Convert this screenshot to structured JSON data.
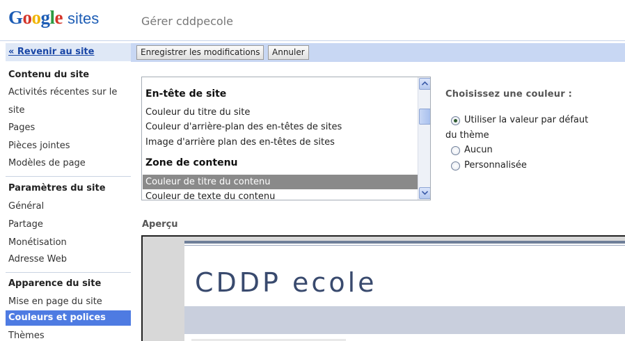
{
  "header": {
    "logo_google": "Google",
    "logo_sites": "sites",
    "title": "Gérer cddpecole",
    "colors": {
      "blue": "#1d5db5",
      "red": "#d4352a",
      "yellow": "#f0b400",
      "green": "#2c9a41"
    }
  },
  "sidebar": {
    "back_link": "« Revenir au site",
    "sections": [
      {
        "title": "Contenu du site",
        "items": [
          "Activités récentes sur le",
          "site",
          "Pages",
          "Pièces jointes",
          "Modèles de page"
        ]
      },
      {
        "title": "Paramètres du site",
        "items": [
          "Général",
          "Partage",
          "Monétisation",
          "Adresse Web"
        ]
      },
      {
        "title": "Apparence du site",
        "items": [
          "Mise en page du site",
          "Couleurs et polices",
          "Thèmes"
        ]
      }
    ],
    "selected": "Couleurs et polices"
  },
  "toolbar": {
    "save_label": "Enregistrer les modifications",
    "cancel_label": "Annuler"
  },
  "list": {
    "clipped_top": "",
    "sections": [
      {
        "title": "En-tête de site",
        "items": [
          "Couleur du titre du site",
          "Couleur d'arrière-plan des en-têtes de sites",
          "Image d'arrière plan des en-têtes de sites"
        ]
      },
      {
        "title": "Zone de contenu",
        "items": [
          "Couleur de titre du contenu",
          "Couleur de texte du contenu"
        ]
      }
    ],
    "selected": "Couleur de titre du contenu"
  },
  "color_choice": {
    "label": "Choisissez une couleur :",
    "options": [
      "Utiliser la valeur par défaut",
      "du thème",
      "Aucun",
      "Personnalisée"
    ],
    "checked": "Utiliser la valeur par défaut du thème"
  },
  "preview": {
    "label": "Aperçu",
    "site_title": "CDDP ecole"
  }
}
